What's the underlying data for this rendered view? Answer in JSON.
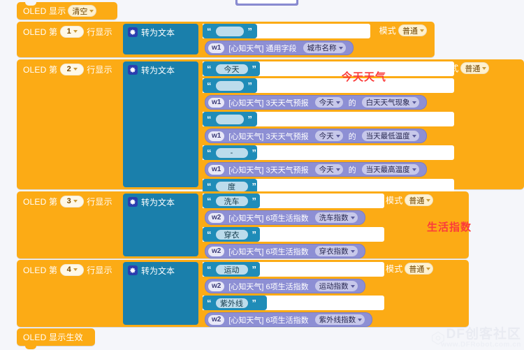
{
  "app": {
    "background": "#f5f6fa",
    "block_colors": {
      "oled": "#fdab15",
      "join": "#1a7fab",
      "string": "#1f8cb8",
      "weather": "#8d8fd4",
      "annotation": "#fb3b3b"
    },
    "watermark": {
      "line1": "DF创客社区",
      "line2": "www.DFRobot.com.cn"
    }
  },
  "annotations": [
    {
      "text": "今天天气"
    },
    {
      "text": "生活指数"
    }
  ],
  "blocks": {
    "clear": {
      "label": "OLED 显示",
      "mode_value": "清空"
    },
    "display_effect": {
      "label": "OLED 显示生效"
    },
    "rows": [
      {
        "prefix": "OLED 第",
        "line": "1",
        "suffix": "行显示",
        "join_label": "转为文本",
        "join_icon": "gear-icon",
        "mode_label": "模式",
        "mode_value": "普通",
        "items": [
          {
            "kind": "string",
            "value": ""
          },
          {
            "kind": "weather",
            "tag": "w1",
            "text": "[心知天气] 通用字段",
            "dropdowns": [
              "城市名称"
            ],
            "connector": ""
          }
        ]
      },
      {
        "prefix": "OLED 第",
        "line": "2",
        "suffix": "行显示",
        "join_label": "转为文本",
        "join_icon": "gear-icon",
        "mode_label": "模式",
        "mode_value": "普通",
        "items": [
          {
            "kind": "string",
            "value": "今天"
          },
          {
            "kind": "string",
            "value": ""
          },
          {
            "kind": "weather",
            "tag": "w1",
            "text": "[心知天气] 3天天气预报",
            "dropdowns": [
              "今天",
              "白天天气现象"
            ],
            "connector": "的"
          },
          {
            "kind": "string",
            "value": ""
          },
          {
            "kind": "weather",
            "tag": "w1",
            "text": "[心知天气] 3天天气预报",
            "dropdowns": [
              "今天",
              "当天最低温度"
            ],
            "connector": "的"
          },
          {
            "kind": "string",
            "value": "-"
          },
          {
            "kind": "weather",
            "tag": "w1",
            "text": "[心知天气] 3天天气预报",
            "dropdowns": [
              "今天",
              "当天最高温度"
            ],
            "connector": "的"
          },
          {
            "kind": "string",
            "value": "度"
          }
        ]
      },
      {
        "prefix": "OLED 第",
        "line": "3",
        "suffix": "行显示",
        "join_label": "转为文本",
        "join_icon": "gear-icon",
        "mode_label": "模式",
        "mode_value": "普通",
        "items": [
          {
            "kind": "string",
            "value": "洗车"
          },
          {
            "kind": "weather",
            "tag": "w2",
            "text": "[心知天气] 6项生活指数",
            "dropdowns": [
              "洗车指数"
            ],
            "connector": ""
          },
          {
            "kind": "string",
            "value": "穿衣"
          },
          {
            "kind": "weather",
            "tag": "w2",
            "text": "[心知天气] 6项生活指数",
            "dropdowns": [
              "穿衣指数"
            ],
            "connector": ""
          }
        ]
      },
      {
        "prefix": "OLED 第",
        "line": "4",
        "suffix": "行显示",
        "join_label": "转为文本",
        "join_icon": "gear-icon",
        "mode_label": "模式",
        "mode_value": "普通",
        "items": [
          {
            "kind": "string",
            "value": "运动"
          },
          {
            "kind": "weather",
            "tag": "w2",
            "text": "[心知天气] 6项生活指数",
            "dropdowns": [
              "运动指数"
            ],
            "connector": ""
          },
          {
            "kind": "string",
            "value": "紫外线"
          },
          {
            "kind": "weather",
            "tag": "w2",
            "text": "[心知天气] 6项生活指数",
            "dropdowns": [
              "紫外线指数"
            ],
            "connector": ""
          }
        ]
      }
    ]
  }
}
